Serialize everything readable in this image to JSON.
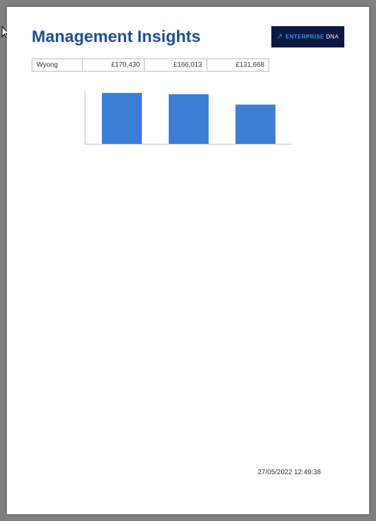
{
  "header": {
    "title": "Management Insights",
    "logo_brand": "ENTERPRISE",
    "logo_suffix": "DNA"
  },
  "table": {
    "rows": [
      {
        "label": "Wyong",
        "v1": "£170,430",
        "v2": "£166,013",
        "v3": "£131,668"
      }
    ]
  },
  "chart_data": {
    "type": "bar",
    "categories": [
      "",
      "",
      ""
    ],
    "values": [
      170430,
      166013,
      131668
    ],
    "title": "",
    "xlabel": "",
    "ylabel": "",
    "ylim": [
      0,
      180000
    ]
  },
  "footer": {
    "timestamp": "27/05/2022 12:49:38"
  }
}
